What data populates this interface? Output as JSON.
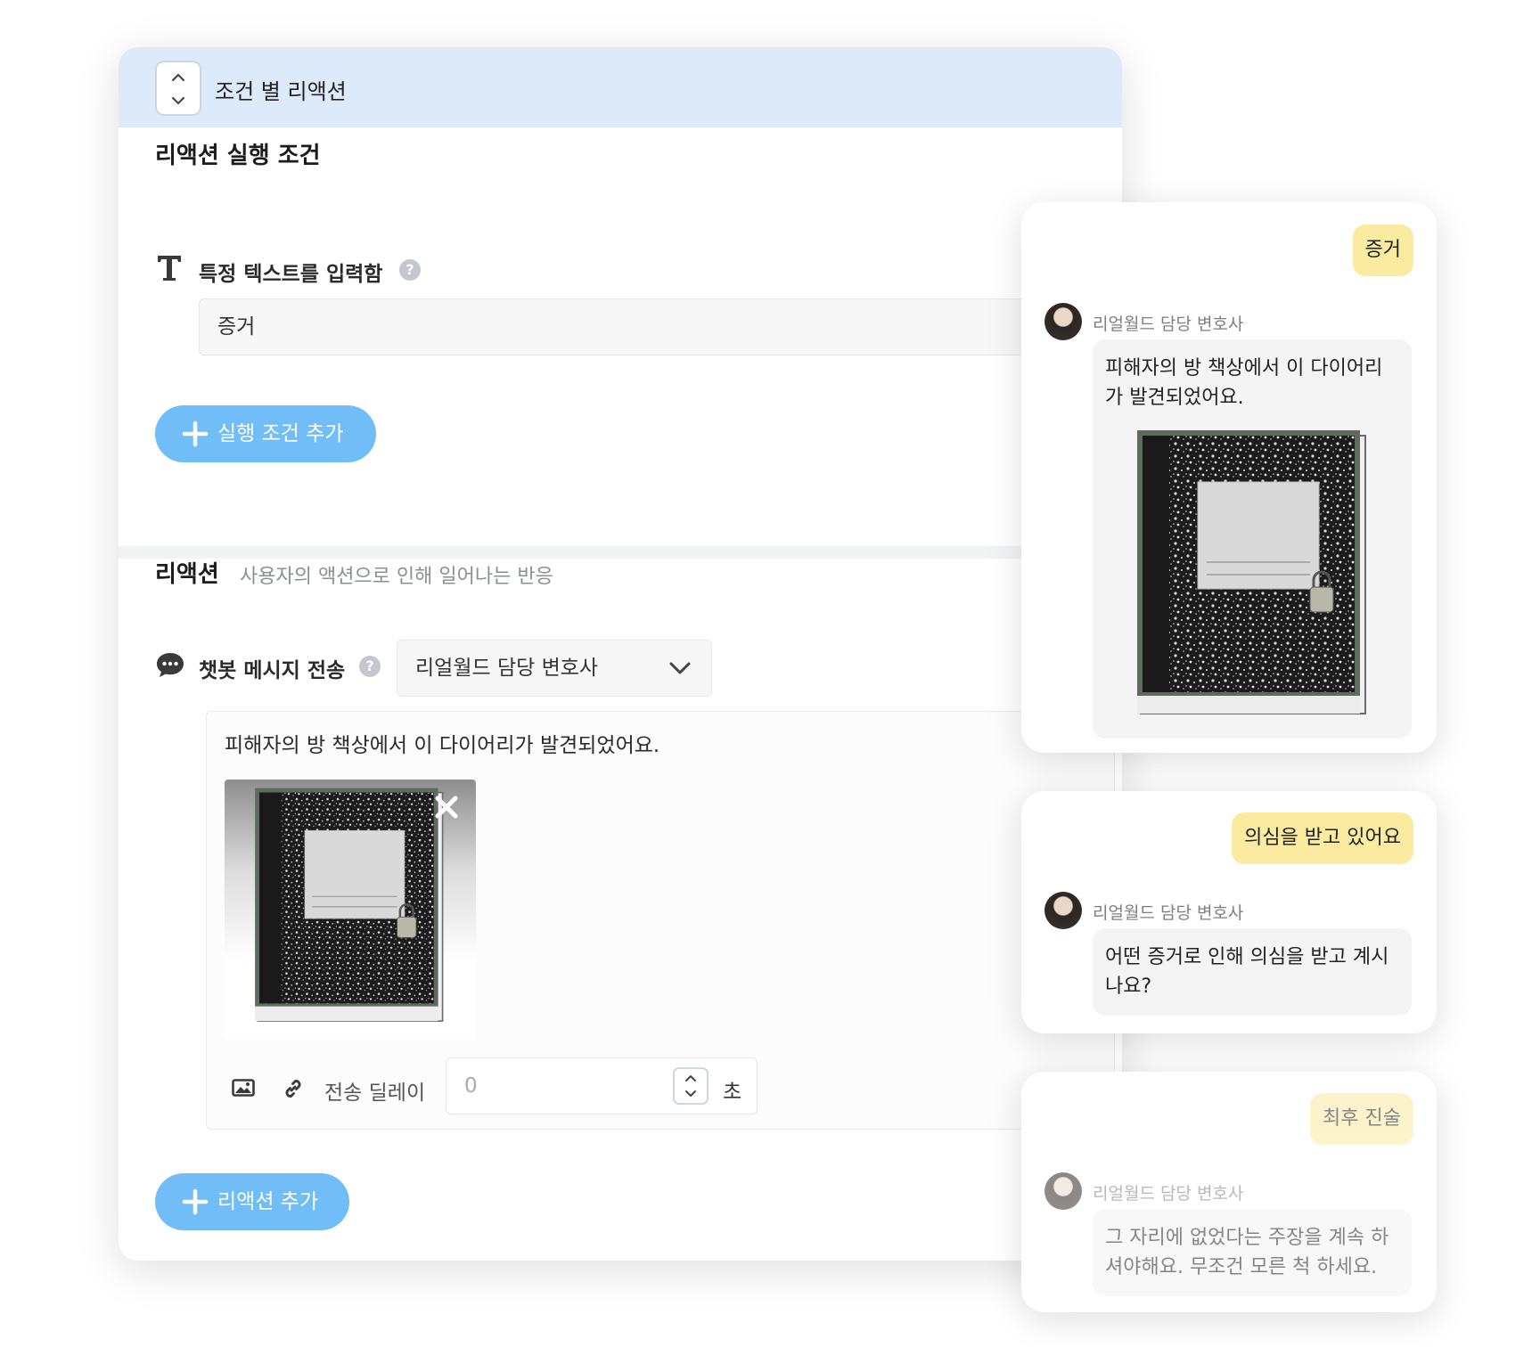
{
  "editor": {
    "header_title": "조건 별 리액션",
    "condition_section": {
      "title": "리액션 실행 조건",
      "condition_label": "특정 텍스트를 입력함",
      "condition_value": "증거",
      "help_glyph": "?",
      "add_condition_label": "실행 조건 추가"
    },
    "reaction_section": {
      "title": "리액션",
      "description": "사용자의 액션으로 인해 일어나는 반응",
      "action_label": "챗봇 메시지 전송",
      "help_glyph": "?",
      "sender_selected": "리얼월드 담당 변호사",
      "message_text": "피해자의 방 책상에서 이 다이어리가 발견되었어요.",
      "attachment_icon": "notebook-image",
      "delay_label": "전송 딜레이",
      "delay_value": "0",
      "delay_unit": "초",
      "add_reaction_label": "리액션 추가"
    },
    "colors": {
      "header_bg": "#ddeafa",
      "accent_button": "#71bdf8"
    }
  },
  "preview": {
    "cards": [
      {
        "user_message": "증거",
        "bot_name": "리얼월드 담당 변호사",
        "bot_message": "피해자의 방 책상에서 이 다이어리가 발견되었어요."
      },
      {
        "user_message": "의심을 받고 있어요",
        "bot_name": "리얼월드 담당 변호사",
        "bot_message": "어떤 증거로 인해 의심을 받고 계시나요?"
      },
      {
        "user_message": "최후 진술",
        "bot_name": "리얼월드 담당 변호사",
        "bot_message": "그 자리에 없었다는 주장을 계속 하셔야해요. 무조건 모른 척 하세요."
      }
    ],
    "colors": {
      "user_bubble": "#fbeba0",
      "bot_bubble": "#f4f4f5"
    }
  }
}
